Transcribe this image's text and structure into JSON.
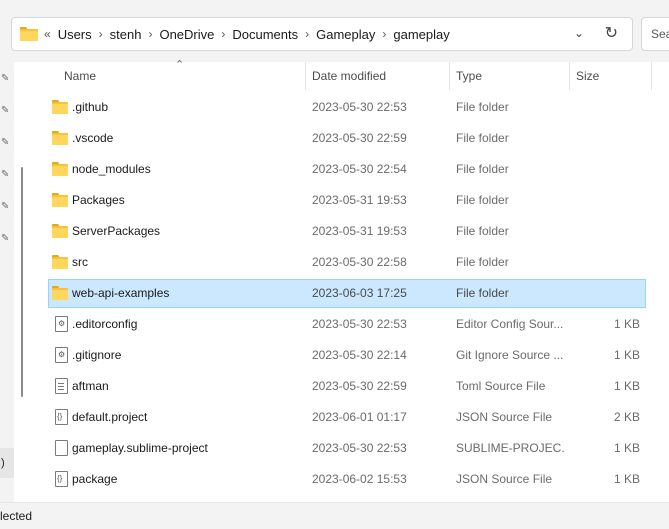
{
  "address_bar": {
    "overflow": "«",
    "crumbs": [
      "Users",
      "stenh",
      "OneDrive",
      "Documents",
      "Gameplay",
      "gameplay"
    ]
  },
  "search": {
    "placeholder": "Sea"
  },
  "columns": {
    "name": "Name",
    "date": "Date modified",
    "type": "Type",
    "size": "Size"
  },
  "files": [
    {
      "name": ".github",
      "date": "2023-05-30 22:53",
      "type": "File folder",
      "size": "",
      "icon": "folder-icon"
    },
    {
      "name": ".vscode",
      "date": "2023-05-30 22:59",
      "type": "File folder",
      "size": "",
      "icon": "folder-icon"
    },
    {
      "name": "node_modules",
      "date": "2023-05-30 22:54",
      "type": "File folder",
      "size": "",
      "icon": "folder-icon"
    },
    {
      "name": "Packages",
      "date": "2023-05-31 19:53",
      "type": "File folder",
      "size": "",
      "icon": "folder-icon"
    },
    {
      "name": "ServerPackages",
      "date": "2023-05-31 19:53",
      "type": "File folder",
      "size": "",
      "icon": "folder-icon"
    },
    {
      "name": "src",
      "date": "2023-05-30 22:58",
      "type": "File folder",
      "size": "",
      "icon": "folder-icon"
    },
    {
      "name": "web-api-examples",
      "date": "2023-06-03 17:25",
      "type": "File folder",
      "size": "",
      "icon": "folder-icon",
      "selected": true
    },
    {
      "name": ".editorconfig",
      "date": "2023-05-30 22:53",
      "type": "Editor Config Sour...",
      "size": "1 KB",
      "icon": "config-file-icon"
    },
    {
      "name": ".gitignore",
      "date": "2023-05-30 22:14",
      "type": "Git Ignore Source ...",
      "size": "1 KB",
      "icon": "config-file-icon"
    },
    {
      "name": "aftman",
      "date": "2023-05-30 22:59",
      "type": "Toml Source File",
      "size": "1 KB",
      "icon": "text-file-icon"
    },
    {
      "name": "default.project",
      "date": "2023-06-01 01:17",
      "type": "JSON Source File",
      "size": "2 KB",
      "icon": "json-file-icon"
    },
    {
      "name": "gameplay.sublime-project",
      "date": "2023-05-30 22:53",
      "type": "SUBLIME-PROJEC...",
      "size": "1 KB",
      "icon": "blank-file-icon"
    },
    {
      "name": "package",
      "date": "2023-06-02 15:53",
      "type": "JSON Source File",
      "size": "1 KB",
      "icon": "json-file-icon"
    }
  ],
  "left_stub": ":)",
  "status": "lected"
}
